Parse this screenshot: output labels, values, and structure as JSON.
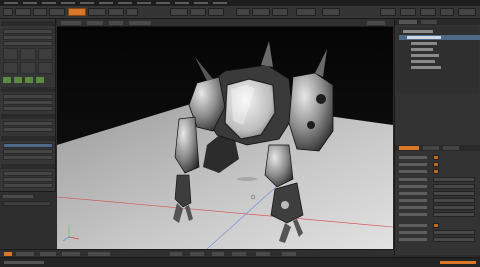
{
  "app": {
    "title": ""
  },
  "colors": {
    "accent": "#d97727",
    "selection": "#4d6a86",
    "viewport_bg": "#0c0c0c"
  },
  "menus": [
    "",
    "",
    "",
    "",
    "",
    "",
    "",
    "",
    "",
    "",
    "",
    "",
    ""
  ],
  "toolbar": {
    "active_tab": ""
  },
  "viewport": {
    "mode_label": ""
  },
  "scene_tree": {
    "items": [
      {
        "label": "",
        "selected": false
      },
      {
        "label": "",
        "selected": true
      },
      {
        "label": "",
        "selected": false
      },
      {
        "label": "",
        "selected": false
      },
      {
        "label": "",
        "selected": false
      },
      {
        "label": "",
        "selected": false
      },
      {
        "label": "",
        "selected": false
      }
    ]
  },
  "properties": {
    "tab": ""
  },
  "status": {
    "left": "",
    "right": ""
  }
}
